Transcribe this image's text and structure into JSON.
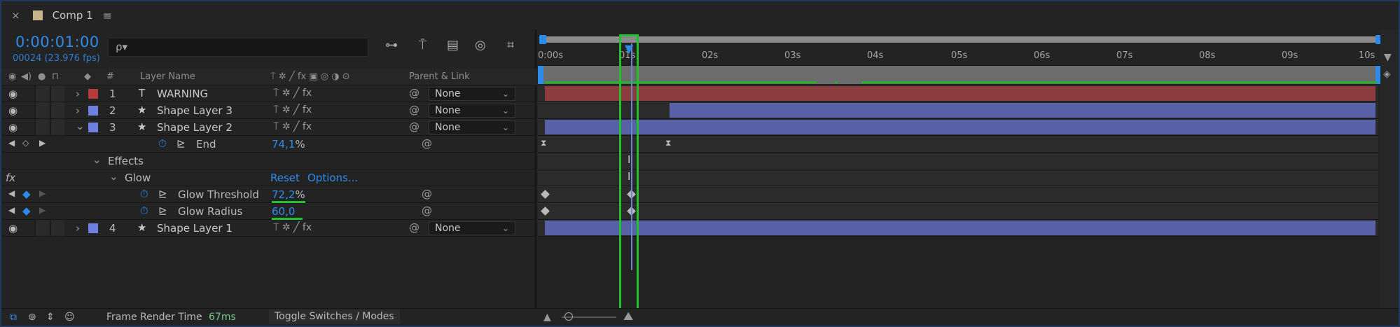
{
  "tab": {
    "close": "×",
    "title": "Comp 1",
    "menu": "≡"
  },
  "timecode": "0:00:01:00",
  "fps": "00024 (23.976 fps)",
  "search": {
    "icon": "ρ▾",
    "placeholder": ""
  },
  "columns": {
    "hash": "#",
    "layer_name": "Layer Name",
    "parent_link": "Parent & Link"
  },
  "layers": [
    {
      "num": "1",
      "type_icon": "T",
      "name": "WARNING",
      "parent": "None",
      "color": "#b53a3a"
    },
    {
      "num": "2",
      "type_icon": "★",
      "name": "Shape Layer 3",
      "parent": "None",
      "color": "#6f7fe0"
    },
    {
      "num": "3",
      "type_icon": "★",
      "name": "Shape Layer 2",
      "parent": "None",
      "color": "#6f7fe0"
    },
    {
      "num": "4",
      "type_icon": "★",
      "name": "Shape Layer 1",
      "parent": "None",
      "color": "#6f7fe0"
    }
  ],
  "end_prop": {
    "name": "End",
    "value": "74,1",
    "unit": "%"
  },
  "effects": {
    "label": "Effects",
    "glow": "Glow",
    "reset": "Reset",
    "options": "Options...",
    "fx": "fx"
  },
  "glow_threshold": {
    "name": "Glow Threshold",
    "value": "72,2",
    "unit": "%"
  },
  "glow_radius": {
    "name": "Glow Radius",
    "value": "60,0"
  },
  "ruler_ticks": [
    "0:00s",
    "01s",
    "02s",
    "03s",
    "04s",
    "05s",
    "06s",
    "07s",
    "08s",
    "09s",
    "10s"
  ],
  "bottom": {
    "frame_render_label": "Frame Render Time",
    "frame_render_value": "67ms",
    "toggle": "Toggle Switches / Modes"
  },
  "colors": {
    "accent": "#2d8ceb",
    "highlight_green": "#22c02c",
    "red_layer": "#8c3b3e",
    "blue_layer": "#5860a6",
    "frame_render": "#71c98a"
  }
}
